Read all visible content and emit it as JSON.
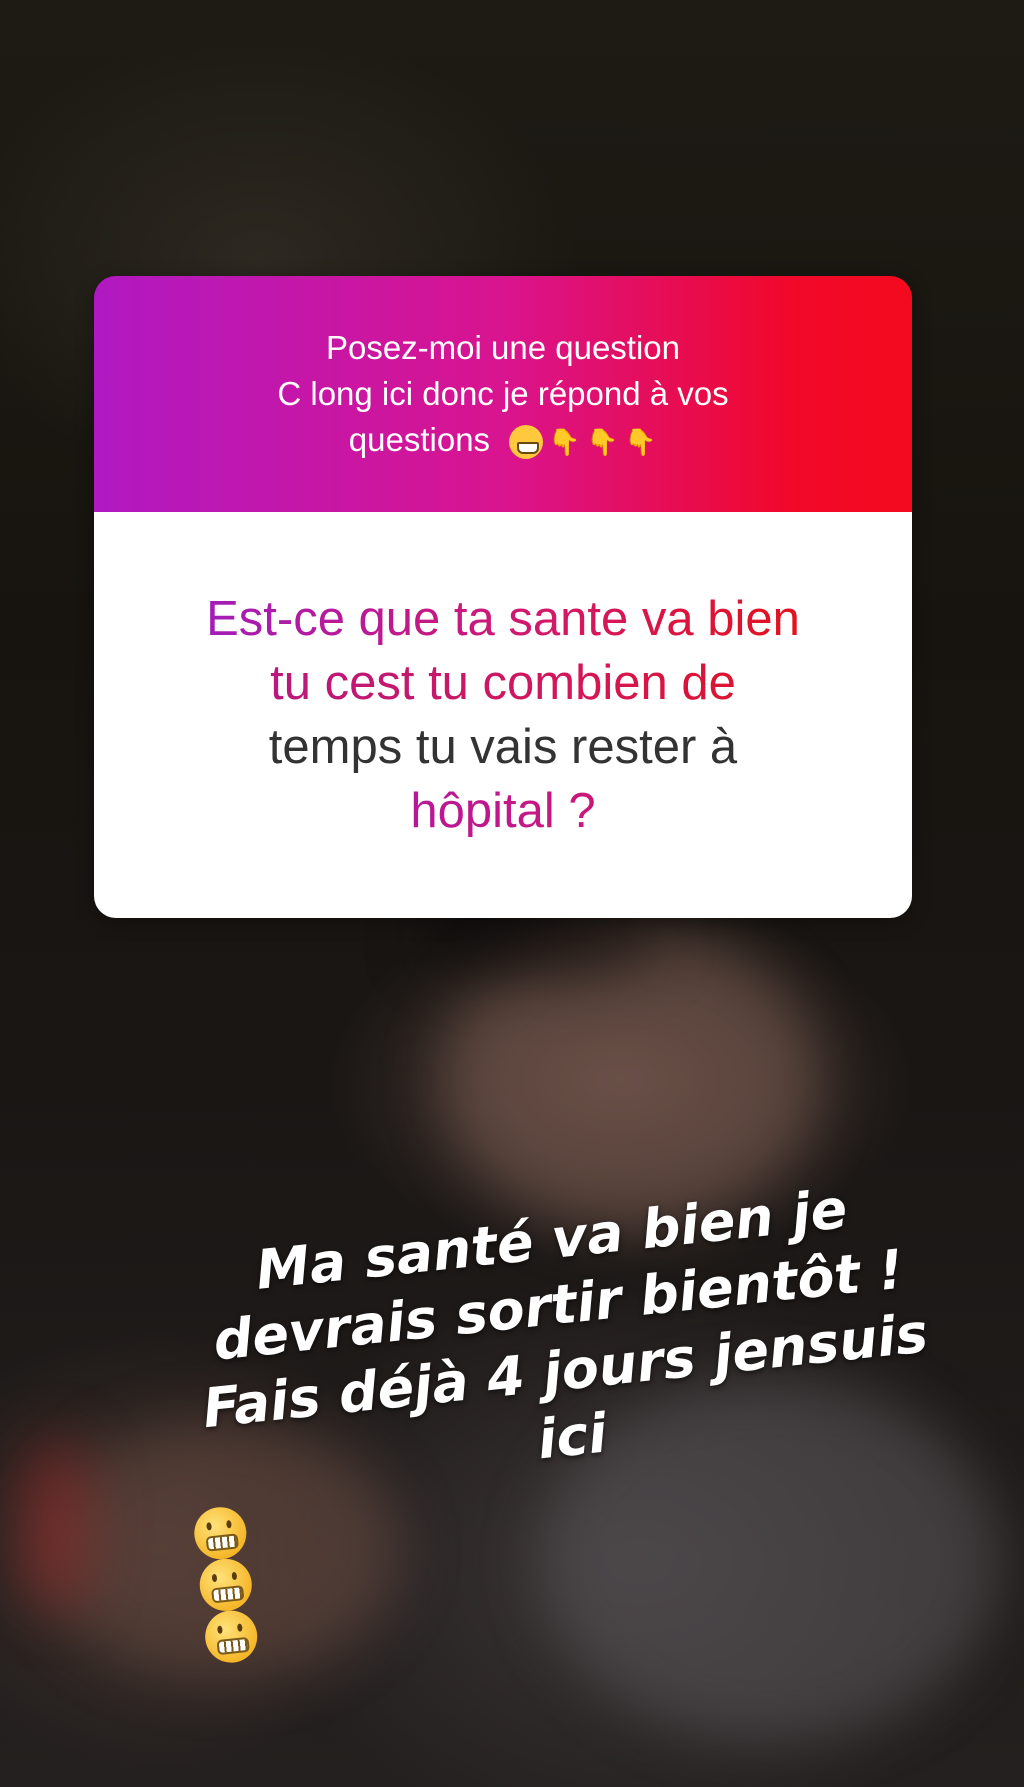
{
  "question_sticker": {
    "prompt_lines": [
      "Posez-moi une question",
      "C long ici donc je répond à vos",
      "questions"
    ],
    "prompt_emojis": [
      "grinning-face",
      "backhand-index-pointing-down",
      "backhand-index-pointing-down",
      "backhand-index-pointing-down"
    ],
    "question_lines": [
      "Est-ce que ta sante va bien",
      "tu cest tu combien de",
      "temps tu vais rester à",
      "hôpital ?"
    ],
    "gradient_colors": [
      "#b019c2",
      "#d9148f",
      "#f40a1e"
    ]
  },
  "answer_text": {
    "lines": [
      "Ma santé va bien je",
      "devrais sortir bientôt !",
      "Fais déjà 4 jours jensuis",
      "ici"
    ],
    "emojis": [
      "grimacing-face",
      "grimacing-face",
      "grimacing-face"
    ],
    "color": "#ffffff"
  }
}
